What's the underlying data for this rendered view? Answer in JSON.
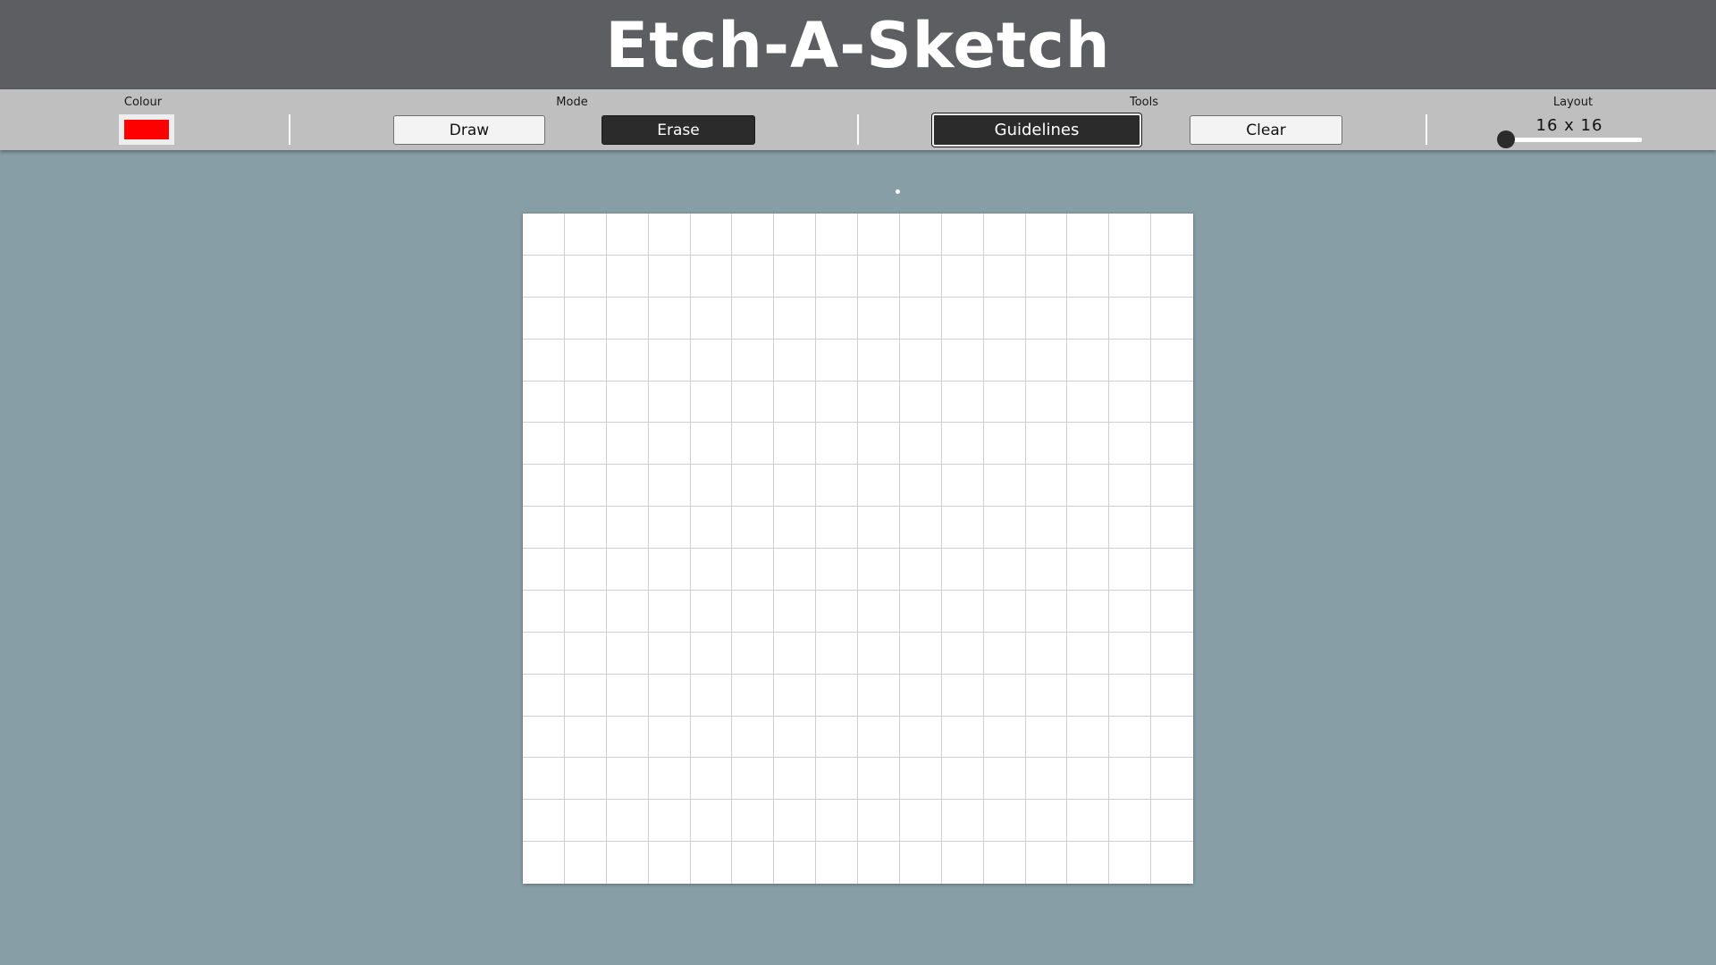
{
  "app": {
    "title": "Etch-A-Sketch"
  },
  "toolbar": {
    "colour": {
      "label": "Colour",
      "value": "#ff0000"
    },
    "mode": {
      "label": "Mode",
      "draw_label": "Draw",
      "erase_label": "Erase",
      "active": "Erase"
    },
    "tools": {
      "label": "Tools",
      "guidelines_label": "Guidelines",
      "guidelines_on": true,
      "clear_label": "Clear"
    },
    "layout": {
      "label": "Layout",
      "value_text": "16 x 16",
      "grid_size": 16,
      "slider_min": 16
    }
  },
  "colors": {
    "title_bar": "#5d5e61",
    "toolbar": "#bfbfbf",
    "background": "#889ea6",
    "button_dark": "#2b2b2b",
    "button_light": "#f3f3f3",
    "grid_line": "#cfcfcf"
  },
  "canvas": {
    "rows": 16,
    "cols": 16,
    "filled_cells": []
  }
}
